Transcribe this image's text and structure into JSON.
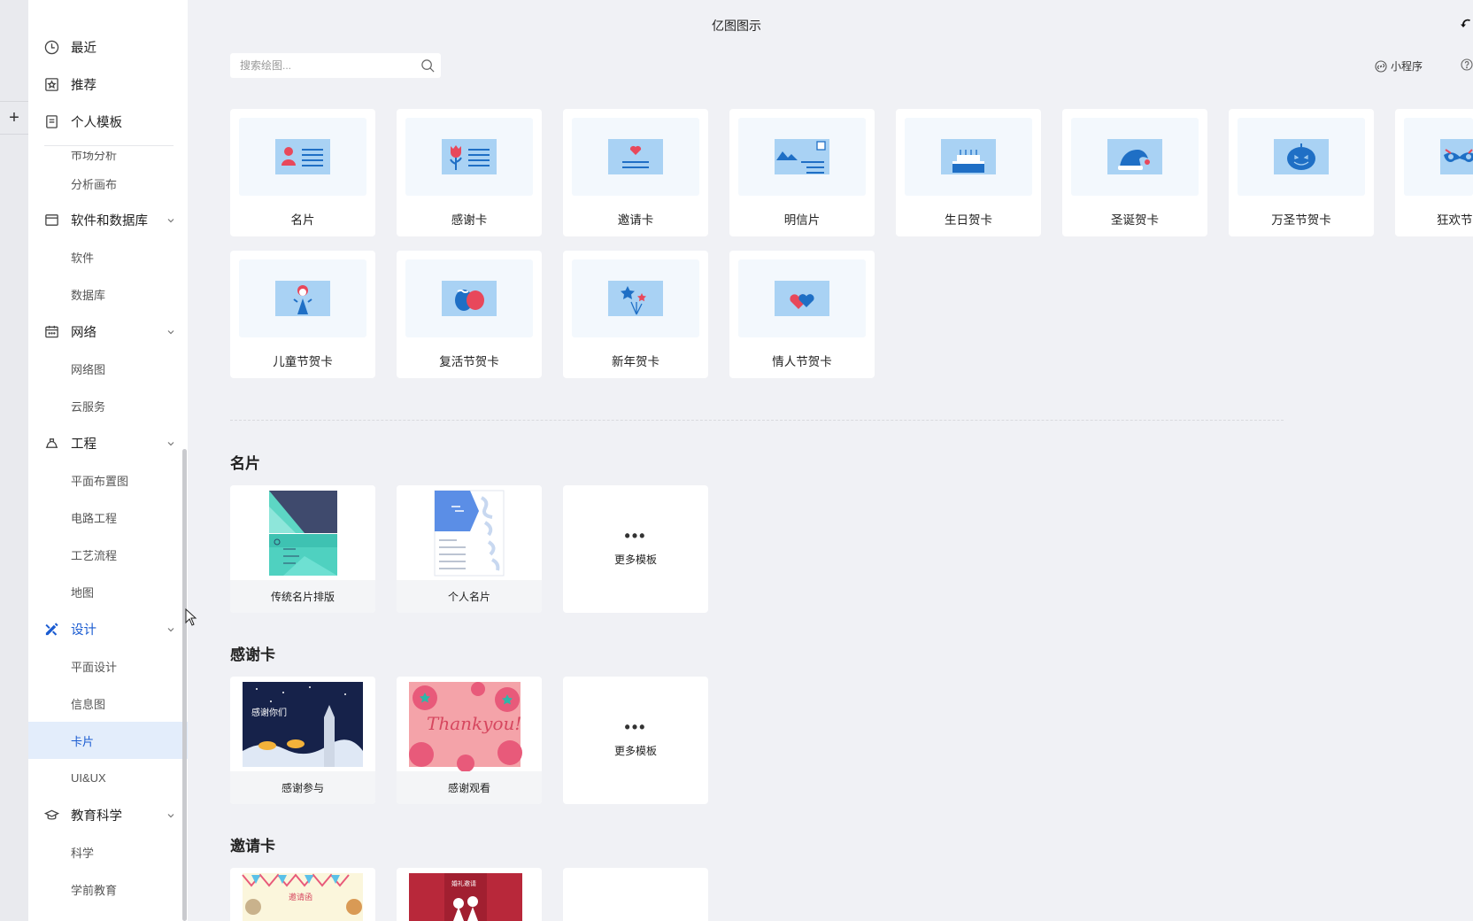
{
  "app": {
    "title": "亿图图示"
  },
  "search": {
    "placeholder": "搜索绘图..."
  },
  "header": {
    "mini_program": "小程序"
  },
  "sidebar": {
    "top_items": [
      {
        "label": "最近",
        "icon": "clock-icon"
      },
      {
        "label": "推荐",
        "icon": "star-badge-icon"
      },
      {
        "label": "个人模板",
        "icon": "document-icon"
      }
    ],
    "cut_item": "市场分析",
    "sub_analysis": "分析画布",
    "groups": [
      {
        "label": "软件和数据库",
        "icon": "window-icon",
        "children": [
          "软件",
          "数据库"
        ]
      },
      {
        "label": "网络",
        "icon": "calendar-network-icon",
        "children": [
          "网络图",
          "云服务"
        ]
      },
      {
        "label": "工程",
        "icon": "helmet-icon",
        "children": [
          "平面布置图",
          "电路工程",
          "工艺流程",
          "地图"
        ]
      },
      {
        "label": "设计",
        "icon": "design-tools-icon",
        "children": [
          "平面设计",
          "信息图",
          "卡片",
          "UI&UX"
        ]
      },
      {
        "label": "教育科学",
        "icon": "graduation-cap-icon",
        "children": [
          "科学",
          "学前教育"
        ]
      }
    ],
    "selected": "卡片"
  },
  "categories": [
    {
      "label": "名片",
      "icon": "business-card-icon"
    },
    {
      "label": "感谢卡",
      "icon": "flower-card-icon"
    },
    {
      "label": "邀请卡",
      "icon": "heart-envelope-icon"
    },
    {
      "label": "明信片",
      "icon": "postcard-icon"
    },
    {
      "label": "生日贺卡",
      "icon": "birthday-cake-icon"
    },
    {
      "label": "圣诞贺卡",
      "icon": "santa-hat-icon"
    },
    {
      "label": "万圣节贺卡",
      "icon": "pumpkin-icon"
    },
    {
      "label": "狂欢节",
      "icon": "carnival-mask-icon"
    },
    {
      "label": "儿童节贺卡",
      "icon": "child-icon"
    },
    {
      "label": "复活节贺卡",
      "icon": "easter-egg-icon"
    },
    {
      "label": "新年贺卡",
      "icon": "fireworks-icon"
    },
    {
      "label": "情人节贺卡",
      "icon": "hearts-icon"
    }
  ],
  "sections": [
    {
      "title": "名片",
      "templates": [
        "传统名片排版",
        "个人名片"
      ],
      "more": "更多模板"
    },
    {
      "title": "感谢卡",
      "templates": [
        "感谢参与",
        "感谢观看"
      ],
      "more": "更多模板"
    },
    {
      "title": "邀请卡",
      "templates": [
        "",
        ""
      ],
      "more": ""
    }
  ],
  "thumb_text": {
    "thank_you": "Thankyou!",
    "thanks_cn": "感谢你们",
    "invite": "邀请函",
    "wedding": "婚礼邀请"
  },
  "colors": {
    "accent": "#1a5bd1",
    "card_art": "#a9d2f4",
    "selected_bg": "#e3edfb"
  }
}
